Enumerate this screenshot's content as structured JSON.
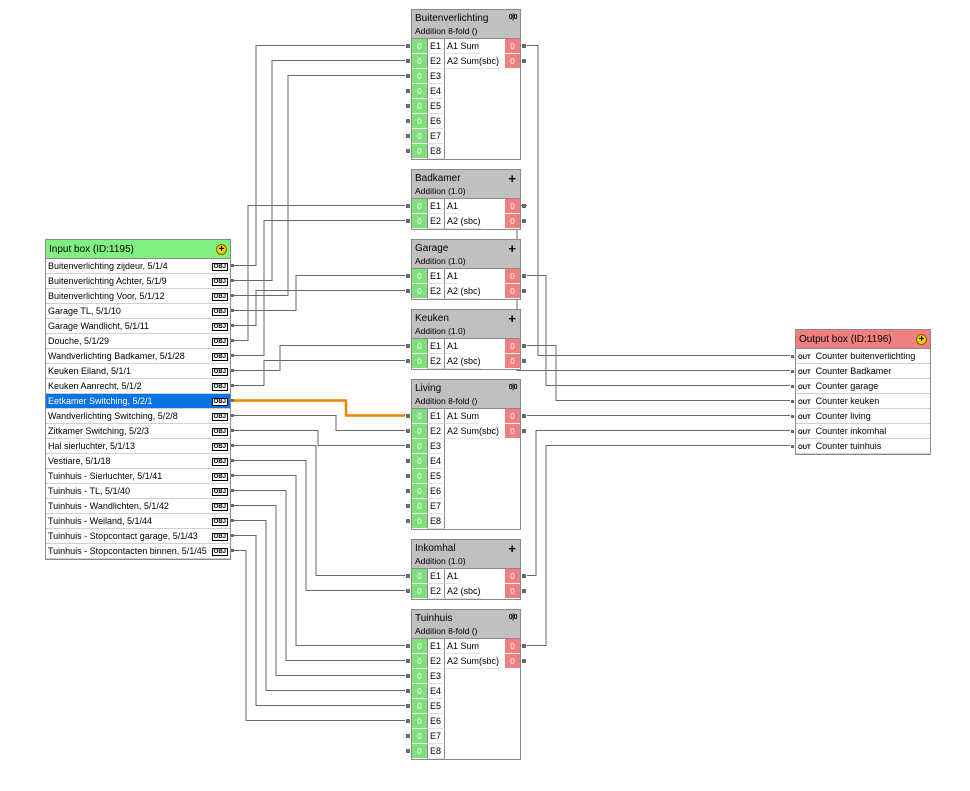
{
  "input_box": {
    "title": "Input box (ID:1195)",
    "selected_index": 9,
    "items": [
      "Buitenverlichting zijdeur, 5/1/4",
      "Buitenverlichting Achter, 5/1/9",
      "Buitenverlichting Voor, 5/1/12",
      "Garage TL, 5/1/10",
      "Garage Wandlicht, 5/1/11",
      "Douche, 5/1/29",
      "Wandverlichting Badkamer, 5/1/28",
      "Keuken Eiland, 5/1/1",
      "Keuken Aanrecht, 5/1/2",
      "Eetkamer Switching, 5/2/1",
      "Wandverlichting Switching, 5/2/8",
      "Zitkamer Switching, 5/2/3",
      "Hal sierluchter, 5/1/13",
      "Vestiare, 5/1/18",
      "Tuinhuis - Sierluchter, 5/1/41",
      "Tuinhuis - TL, 5/1/40",
      "Tuinhuis - Wandlichten, 5/1/42",
      "Tuinhuis - Weiland, 5/1/44",
      "Tuinhuis - Stopcontact garage, 5/1/43",
      "Tuinhuis - Stopcontacten binnen, 5/1/45"
    ],
    "obj_label": "OBJ"
  },
  "output_box": {
    "title": "Output box (ID:1196)",
    "out_label": "OUT",
    "items": [
      "Counter buitenverlichting",
      "Counter Badkamer",
      "Counter garage",
      "Counter keuken",
      "Counter living",
      "Counter inkomhal",
      "Counter tuinhuis"
    ]
  },
  "icons": {
    "plus": "+",
    "bits": "0|0"
  },
  "colors": {
    "input_green": "#7de07d",
    "output_red": "#f08080",
    "selection": "#0a73e6",
    "active_wire": "#f08000"
  },
  "blocks": [
    {
      "id": "buitenverlichting",
      "title": "Buitenverlichting",
      "subtitle": "Addition 8-fold ()",
      "icon": "bits",
      "inputs": [
        "E1",
        "E2",
        "E3",
        "E4",
        "E5",
        "E6",
        "E7",
        "E8"
      ],
      "outputs": [
        "A1 Sum",
        "A2 Sum(sbc)"
      ],
      "input_value": "0",
      "output_value": "0"
    },
    {
      "id": "badkamer",
      "title": "Badkamer",
      "subtitle": "Addition (1.0)",
      "icon": "plus",
      "inputs": [
        "E1",
        "E2"
      ],
      "outputs": [
        "A1",
        "A2 (sbc)"
      ],
      "input_value": "0",
      "output_value": "0"
    },
    {
      "id": "garage",
      "title": "Garage",
      "subtitle": "Addition (1.0)",
      "icon": "plus",
      "inputs": [
        "E1",
        "E2"
      ],
      "outputs": [
        "A1",
        "A2 (sbc)"
      ],
      "input_value": "0",
      "output_value": "0"
    },
    {
      "id": "keuken",
      "title": "Keuken",
      "subtitle": "Addition (1.0)",
      "icon": "plus",
      "inputs": [
        "E1",
        "E2"
      ],
      "outputs": [
        "A1",
        "A2 (sbc)"
      ],
      "input_value": "0",
      "output_value": "0"
    },
    {
      "id": "living",
      "title": "Living",
      "subtitle": "Addition 8-fold ()",
      "icon": "bits",
      "inputs": [
        "E1",
        "E2",
        "E3",
        "E4",
        "E5",
        "E6",
        "E7",
        "E8"
      ],
      "outputs": [
        "A1 Sum",
        "A2 Sum(sbc)"
      ],
      "input_value": "0",
      "output_value": "0"
    },
    {
      "id": "inkomhal",
      "title": "Inkomhal",
      "subtitle": "Addition (1.0)",
      "icon": "plus",
      "inputs": [
        "E1",
        "E2"
      ],
      "outputs": [
        "A1",
        "A2 (sbc)"
      ],
      "input_value": "0",
      "output_value": "0"
    },
    {
      "id": "tuinhuis",
      "title": "Tuinhuis",
      "subtitle": "Addition 8-fold ()",
      "icon": "bits",
      "inputs": [
        "E1",
        "E2",
        "E3",
        "E4",
        "E5",
        "E6",
        "E7",
        "E8"
      ],
      "outputs": [
        "A1 Sum",
        "A2 Sum(sbc)"
      ],
      "input_value": "0",
      "output_value": "0"
    }
  ]
}
